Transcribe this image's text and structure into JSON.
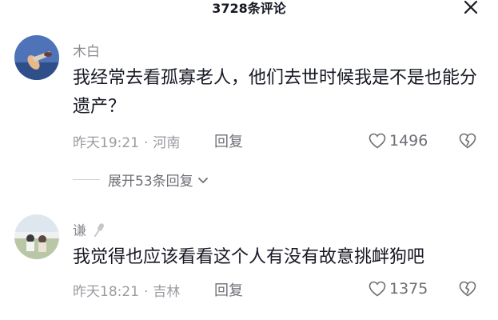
{
  "header": {
    "title": "3728条评论"
  },
  "comments": [
    {
      "username": "木白",
      "text": "我经常去看孤寡老人，他们去世时候我是不是也能分遗产？",
      "time": "昨天19:21",
      "separator": "·",
      "location": "河南",
      "reply_label": "回复",
      "likes": "1496"
    },
    {
      "username": "谦",
      "text": "我觉得也应该看看这个人有没有故意挑衅狗吧",
      "time": "昨天18:21",
      "separator": "·",
      "location": "吉林",
      "reply_label": "回复",
      "likes": "1375"
    }
  ],
  "expand_replies": "展开53条回复",
  "icons": {
    "close": "close-icon",
    "like": "heart-outline-icon",
    "dislike": "broken-heart-icon",
    "expand": "chevron-down-icon",
    "mic": "microphone-icon"
  },
  "colors": {
    "primary_text": "#161823",
    "secondary_text": "#8a8b91",
    "icon_gray": "#6e6f75"
  }
}
